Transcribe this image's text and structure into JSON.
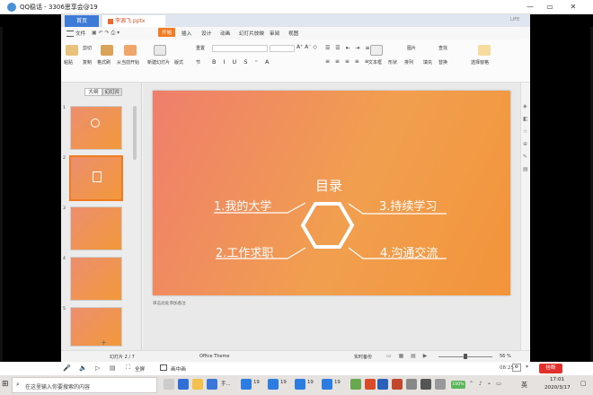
{
  "qq_window": {
    "title": "QQ稳话 - 3306思享会@19",
    "buttons": [
      "—",
      "▭",
      "✕"
    ]
  },
  "wps": {
    "tabs": {
      "home": "首页",
      "document": "李源飞.pptx",
      "right_label": "LIFE"
    },
    "menu": {
      "file": "文件",
      "items": [
        "开始",
        "插入",
        "设计",
        "动画",
        "幻灯片放映",
        "审阅",
        "视图"
      ],
      "active": "开始"
    },
    "ribbon": {
      "paste": "粘贴",
      "cut": "剪切",
      "copy": "复制",
      "format_painter": "格式刷",
      "from_current": "从当前开始",
      "new_slide": "新建幻灯片",
      "layout": "版式",
      "reset": "重置",
      "section": "节",
      "textbox": "文本框",
      "shape": "形状",
      "arrange": "排列",
      "picture": "图片",
      "fill": "填充",
      "find": "查找",
      "replace": "替换",
      "select_pane": "选择窗格"
    },
    "panel": {
      "tab_outline": "大纲",
      "tab_slides": "幻灯片",
      "slide_numbers": [
        "1",
        "2",
        "3",
        "4",
        "5"
      ],
      "add": "+"
    },
    "slide": {
      "title": "目录",
      "items": [
        "1.我的大学",
        "2.工作求职",
        "3.持续学习",
        "4.沟通交流"
      ]
    },
    "notes_placeholder": "单击此处添加备注",
    "status": {
      "slide_counter": "幻灯片 2 / 7",
      "theme": "Office Theme",
      "backup": "实时备份",
      "zoom": "56 %"
    }
  },
  "qq_toolbar": {
    "fullscreen": "全屏",
    "pip": "画中画",
    "time": "08:25",
    "end_button": "挂断"
  },
  "taskbar": {
    "search_placeholder": "在这里输入你要搜索的内容",
    "apps": [
      "手...",
      "19",
      "19",
      "19",
      "19"
    ],
    "time": "17:01",
    "date": "2020/3/17",
    "lang": "英",
    "battery": "100%"
  },
  "colors": {
    "accent": "#f27b22",
    "slide_grad_start": "#ef7e6c",
    "slide_grad_end": "#f2943a",
    "qq_blue": "#4a90d9",
    "end_red": "#e2302c"
  }
}
